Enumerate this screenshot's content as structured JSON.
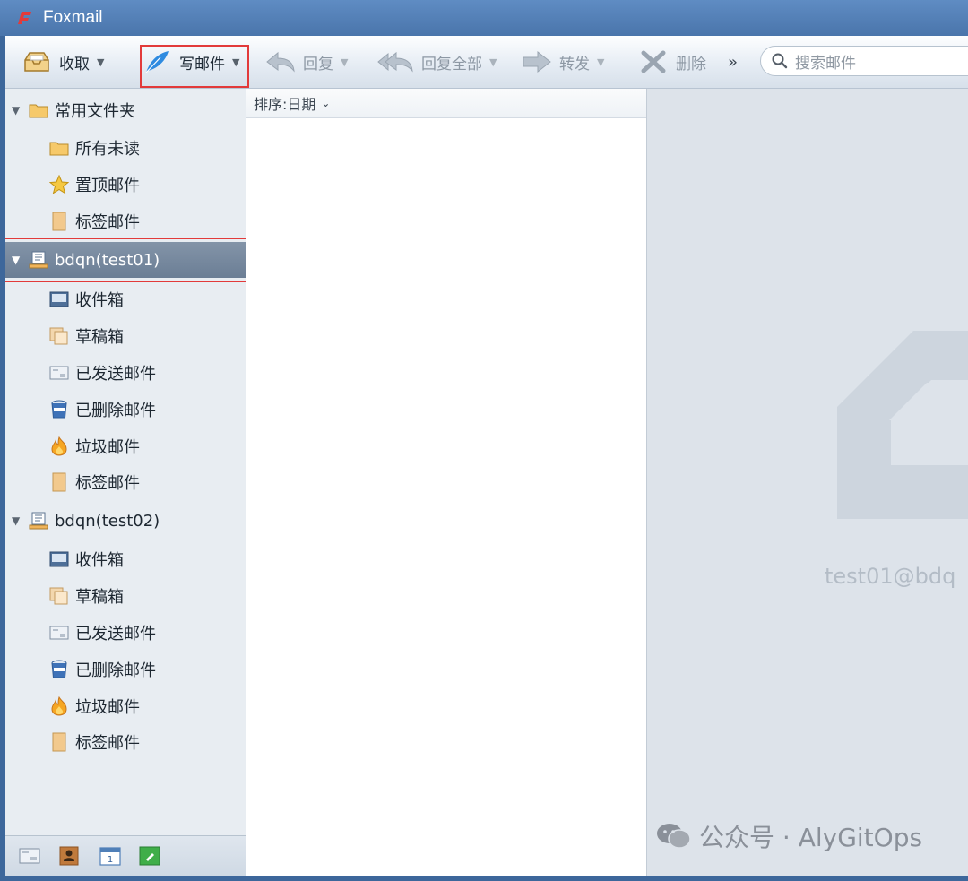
{
  "window": {
    "title": "Foxmail"
  },
  "toolbar": {
    "receive_label": "收取",
    "compose_label": "写邮件",
    "reply_label": "回复",
    "reply_all_label": "回复全部",
    "forward_label": "转发",
    "delete_label": "删除",
    "more_label": "»",
    "search_placeholder": "搜索邮件"
  },
  "sidebar": {
    "favorites": {
      "label": "常用文件夹",
      "items": [
        "所有未读",
        "置顶邮件",
        "标签邮件"
      ]
    },
    "accounts": [
      {
        "label": "bdqn(test01)",
        "items": [
          "收件箱",
          "草稿箱",
          "已发送邮件",
          "已删除邮件",
          "垃圾邮件",
          "标签邮件"
        ]
      },
      {
        "label": "bdqn(test02)",
        "items": [
          "收件箱",
          "草稿箱",
          "已发送邮件",
          "已删除邮件",
          "垃圾邮件",
          "标签邮件"
        ]
      }
    ]
  },
  "maillist": {
    "sort_label": "排序:日期"
  },
  "preview": {
    "account_email": "test01@bdq"
  },
  "watermark": {
    "text": "公众号 · AlyGitOps"
  },
  "colors": {
    "accent": "#4a75ab",
    "highlight": "#e23a3a",
    "selected_row": "#6b7e95"
  }
}
